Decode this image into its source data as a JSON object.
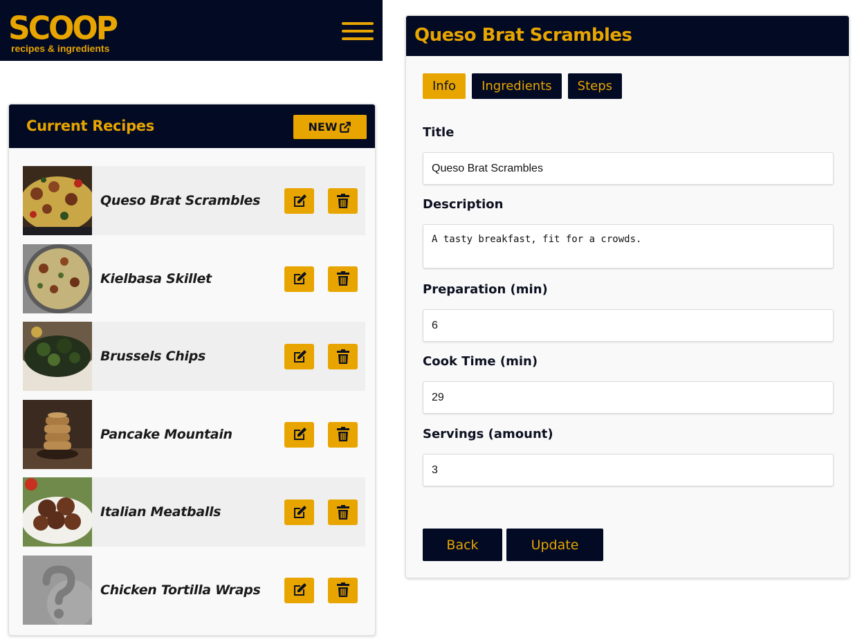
{
  "header": {
    "logo_main": "SCOOP",
    "logo_sub": "recipes & ingredients"
  },
  "recipes": {
    "title": "Current Recipes",
    "new_label": "NEW",
    "items": [
      {
        "name": "Queso Brat Scrambles"
      },
      {
        "name": "Kielbasa Skillet"
      },
      {
        "name": "Brussels Chips"
      },
      {
        "name": "Pancake Mountain"
      },
      {
        "name": "Italian Meatballs"
      },
      {
        "name": "Chicken Tortilla Wraps"
      }
    ]
  },
  "detail": {
    "title": "Queso Brat Scrambles",
    "tabs": [
      {
        "label": "Info",
        "active": true
      },
      {
        "label": "Ingredients",
        "active": false
      },
      {
        "label": "Steps",
        "active": false
      }
    ],
    "fields": {
      "title_label": "Title",
      "title_value": "Queso Brat Scrambles",
      "description_label": "Description",
      "description_value": "A tasty breakfast, fit for a crowds.",
      "prep_label": "Preparation (min)",
      "prep_value": "6",
      "cook_label": "Cook Time (min)",
      "cook_value": "29",
      "servings_label": "Servings (amount)",
      "servings_value": "3"
    },
    "back_label": "Back",
    "update_label": "Update"
  },
  "colors": {
    "navy": "#020a24",
    "gold": "#e8a500"
  }
}
